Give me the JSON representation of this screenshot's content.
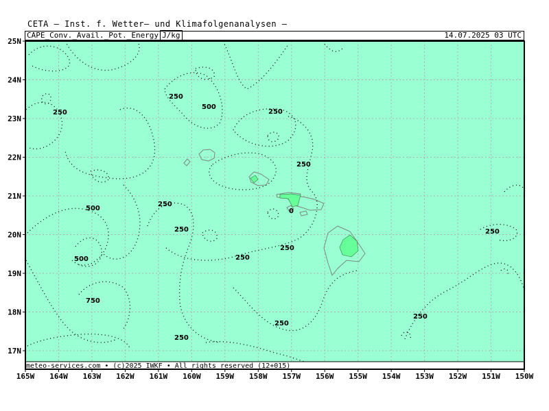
{
  "header": {
    "title": "CETA — Inst. f. Wetter— und Klimafolgenanalysen —"
  },
  "subheader": {
    "field": "CAPE_Conv._Avail._Pot._Energy",
    "unit": "J/kg",
    "valid_time": "14.07.2025 03 UTC"
  },
  "footer": {
    "credit": "meteo-services.com • (c)2025 IWKF • All rights reserved (12+015)"
  },
  "map": {
    "background_color": "#9affd2",
    "accent_color": "#66ff99",
    "lat_labels": [
      "25N",
      "24N",
      "23N",
      "22N",
      "21N",
      "20N",
      "19N",
      "18N",
      "17N"
    ],
    "lon_labels": [
      "165W",
      "164W",
      "163W",
      "162W",
      "161W",
      "160W",
      "159W",
      "158W",
      "157W",
      "156W",
      "155W",
      "154W",
      "153W",
      "152W",
      "151W",
      "150W"
    ],
    "contour_labels": [
      {
        "text": "250"
      },
      {
        "text": "250"
      },
      {
        "text": "500"
      },
      {
        "text": "250"
      },
      {
        "text": "250"
      },
      {
        "text": "500"
      },
      {
        "text": "250"
      },
      {
        "text": "250"
      },
      {
        "text": "0"
      },
      {
        "text": "250"
      },
      {
        "text": "500"
      },
      {
        "text": "250"
      },
      {
        "text": "250"
      },
      {
        "text": "750"
      },
      {
        "text": "250"
      },
      {
        "text": "250"
      },
      {
        "text": "250"
      },
      {
        "text": "250"
      }
    ]
  }
}
